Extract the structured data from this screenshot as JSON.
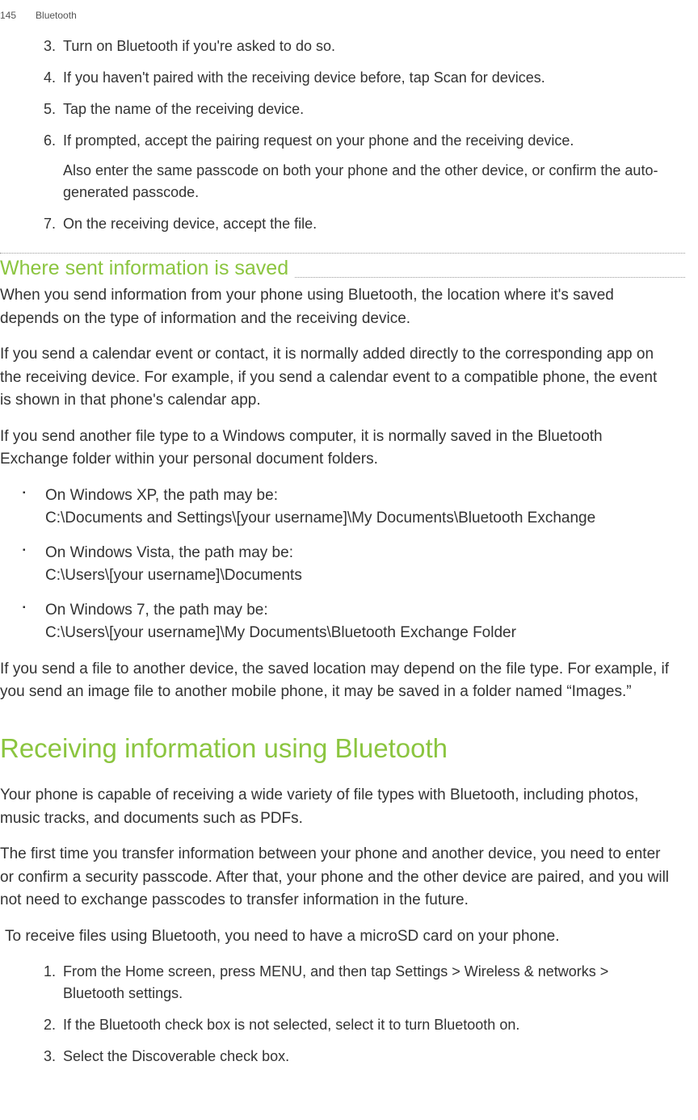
{
  "header": {
    "page_num": "145",
    "section": "Bluetooth"
  },
  "steps_a": [
    {
      "num": "3.",
      "text": "Turn on Bluetooth if you're asked to do so."
    },
    {
      "num": "4.",
      "pre": "If you haven't paired with the receiving device before, tap ",
      "bold": "Scan for devices",
      "post": "."
    },
    {
      "num": "5.",
      "text": "Tap the name of the receiving device."
    },
    {
      "num": "6.",
      "p1": "If prompted, accept the pairing request on your phone and the receiving device.",
      "p2": "Also enter the same passcode on both your phone and the other device, or confirm the auto-generated passcode."
    },
    {
      "num": "7.",
      "text": "On the receiving device, accept the file."
    }
  ],
  "subhead": "Where sent information is saved",
  "paras": {
    "p1": "When you send information from your phone using Bluetooth, the location where it's saved depends on the type of information and the receiving device.",
    "p2": "If you send a calendar event or contact, it is normally added directly to the corresponding app on the receiving device. For example, if you send a calendar event to a compatible phone, the event is shown in that phone's calendar app.",
    "p3": "If you send another file type to a Windows computer, it is normally saved in the Bluetooth Exchange folder within your personal document folders."
  },
  "bullets": [
    {
      "l1": "On Windows XP, the path may be:",
      "l2": "C:\\Documents and Settings\\[your username]\\My Documents\\Bluetooth Exchange"
    },
    {
      "l1": "On Windows Vista, the path may be:",
      "l2": "C:\\Users\\[your username]\\Documents"
    },
    {
      "l1": "On Windows 7, the path may be:",
      "l2": "C:\\Users\\[your username]\\My Documents\\Bluetooth Exchange Folder"
    }
  ],
  "p_after_bullets": "If you send a file to another device, the saved location may depend on the file type. For example, if you send an image file to another mobile phone, it may be saved in a folder named “Images.”",
  "h1": "Receiving information using Bluetooth",
  "recv": {
    "p1": "Your phone is capable of receiving a wide variety of file types with Bluetooth, including photos, music tracks, and documents such as PDFs.",
    "p2": "The first time you transfer information between your phone and another device, you need to enter or confirm a security passcode. After that, your phone and the other device are paired, and you will not need to exchange passcodes to transfer information in the future.",
    "p3": " To receive files using Bluetooth, you need to have a microSD card on your phone."
  },
  "steps_b": {
    "s1": {
      "num": "1.",
      "pre": "From the Home screen, press MENU, and then tap ",
      "b1": "Settings",
      "gt1": " > ",
      "b2": "Wireless & networks",
      "gt2": " > ",
      "b3": "Bluetooth settings",
      "post": "."
    },
    "s2": {
      "num": "2.",
      "pre": "If the ",
      "b1": "Bluetooth",
      "post": " check box is not selected, select it to turn Bluetooth on."
    },
    "s3": {
      "num": "3.",
      "pre": "Select the ",
      "b1": "Discoverable",
      "post": " check box."
    }
  }
}
